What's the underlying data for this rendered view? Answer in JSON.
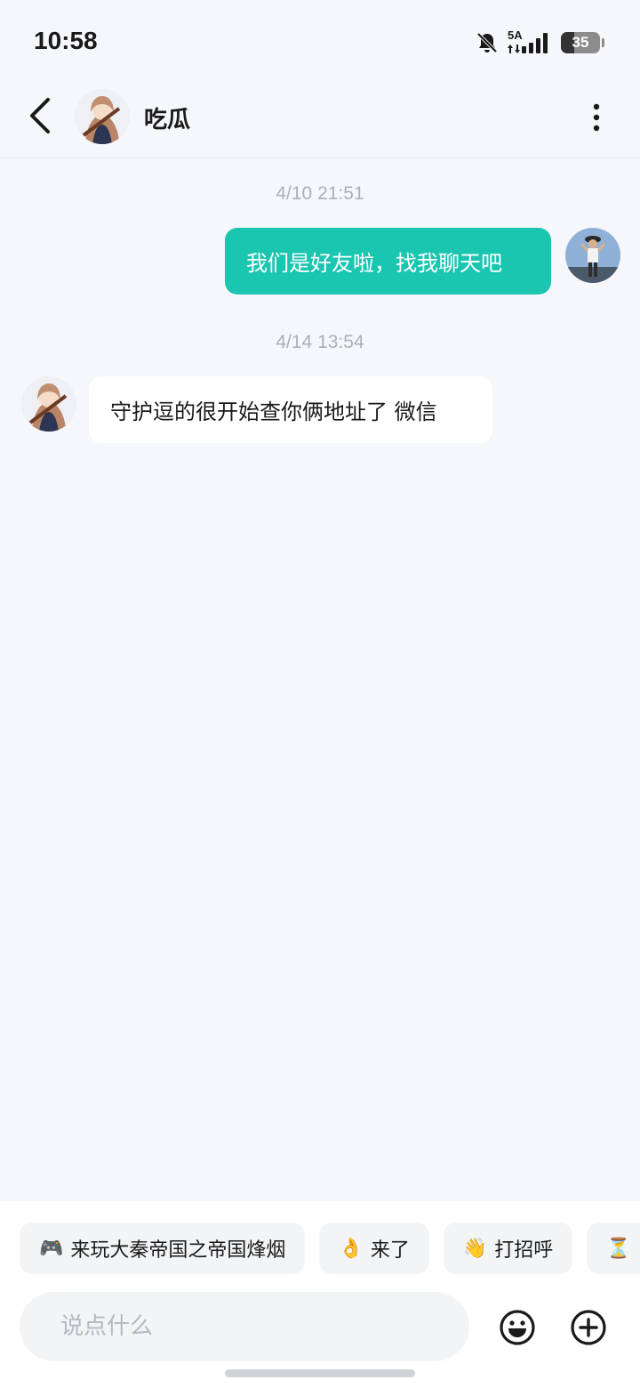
{
  "status_bar": {
    "time": "10:58",
    "network": "5A",
    "battery_level": "35",
    "battery_fraction": 0.35
  },
  "header": {
    "title": "吃瓜",
    "back_icon": "chevron-left-icon",
    "more_icon": "vertical-dots-icon"
  },
  "messages": [
    {
      "timestamp": "4/10  21:51",
      "direction": "out",
      "text": "我们是好友啦，找我聊天吧"
    },
    {
      "timestamp": "4/14  13:54",
      "direction": "in",
      "text": "守护逗的很开始查你俩地址了 微信"
    }
  ],
  "quick_replies": [
    {
      "emoji": "🎮",
      "label": "来玩大秦帝国之帝国烽烟"
    },
    {
      "emoji": "👌",
      "label": "来了"
    },
    {
      "emoji": "👋",
      "label": "打招呼"
    },
    {
      "emoji": "⏳",
      "label": ""
    }
  ],
  "input": {
    "placeholder": "说点什么",
    "value": ""
  },
  "colors": {
    "accent": "#1ac6b0",
    "background": "#f5f7fa",
    "timestamp": "#aab0b8"
  }
}
